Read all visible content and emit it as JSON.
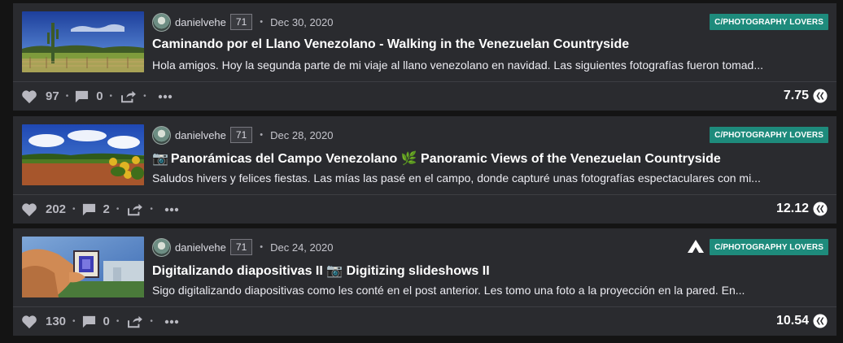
{
  "posts": [
    {
      "thumbnail": "countryside-cactus-landscape",
      "author": "danielvehe",
      "reputation": "71",
      "date": "Dec 30, 2020",
      "community": "C/PHOTOGRAPHY LOVERS",
      "title_icon": "",
      "title": "Caminando por el Llano Venezolano - Walking in the Venezuelan Countryside",
      "excerpt": "Hola amigos. Hoy la segunda parte de mi viaje al llano venezolano en navidad. Las siguientes fotografías fueron tomad...",
      "votes": "97",
      "comments": "0",
      "payout": "7.75"
    },
    {
      "thumbnail": "panoramic-field-sky",
      "author": "danielvehe",
      "reputation": "71",
      "date": "Dec 28, 2020",
      "community": "C/PHOTOGRAPHY LOVERS",
      "title_icon": "📷",
      "title": "Panorámicas del Campo Venezolano 🌿 Panoramic Views of the Venezuelan Countryside",
      "excerpt": "Saludos hivers y felices fiestas. Las mías las pasé en el campo, donde capturé unas fotografías espectaculares con mi...",
      "votes": "202",
      "comments": "2",
      "payout": "12.12"
    },
    {
      "thumbnail": "hand-holding-slide",
      "author": "danielvehe",
      "reputation": "71",
      "date": "Dec 24, 2020",
      "community": "C/PHOTOGRAPHY LOVERS",
      "title_icon": "",
      "title": "Digitalizando diapositivas II 📷 Digitizing slideshows II",
      "excerpt": "Sigo digitalizando diapositivas como les conté en el post anterior. Les tomo una foto a la proyección en la pared. En...",
      "votes": "130",
      "comments": "0",
      "payout": "10.54"
    }
  ],
  "colors": {
    "background": "#141414",
    "card": "#2a2b2f",
    "community_badge": "#1e8b7c"
  },
  "icons": [
    "heart-icon",
    "comment-icon",
    "reblog-icon",
    "more-icon",
    "hive-icon",
    "pro-icon"
  ]
}
